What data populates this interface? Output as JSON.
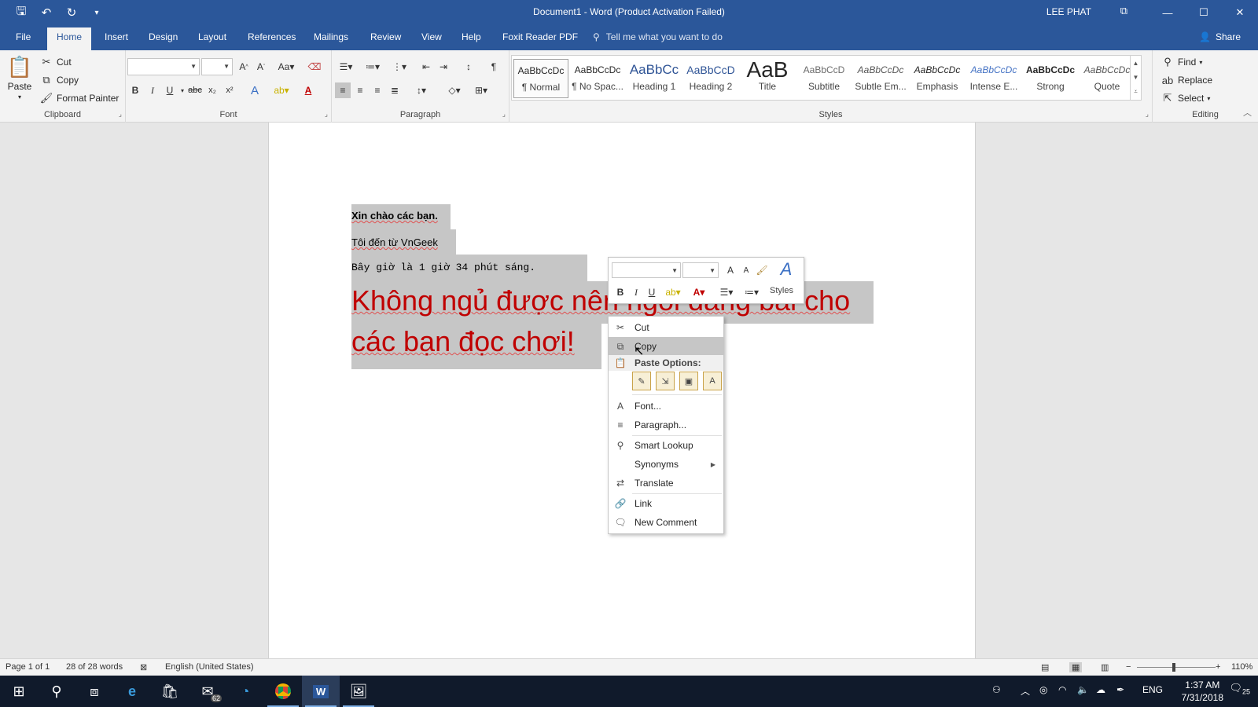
{
  "window": {
    "title": "Document1  -  Word (Product Activation Failed)",
    "user": "LEE PHAT",
    "controls": [
      "⧉",
      "—",
      "☐",
      "✕"
    ]
  },
  "tabs": [
    "File",
    "Home",
    "Insert",
    "Design",
    "Layout",
    "References",
    "Mailings",
    "Review",
    "View",
    "Help",
    "Foxit Reader PDF"
  ],
  "active_tab": "Home",
  "tell_me": "Tell me what you want to do",
  "share": "Share",
  "clipboard": {
    "label": "Clipboard",
    "paste": "Paste",
    "cut": "Cut",
    "copy": "Copy",
    "format_painter": "Format Painter"
  },
  "font_group": {
    "label": "Font",
    "font_name": "",
    "font_size": ""
  },
  "paragraph_group": {
    "label": "Paragraph"
  },
  "styles": {
    "label": "Styles",
    "items": [
      {
        "preview": "AaBbCcDc",
        "name": "¶ Normal"
      },
      {
        "preview": "AaBbCcDc",
        "name": "¶ No Spac..."
      },
      {
        "preview": "AaBbCc",
        "name": "Heading 1"
      },
      {
        "preview": "AaBbCcD",
        "name": "Heading 2"
      },
      {
        "preview": "AaB",
        "name": "Title"
      },
      {
        "preview": "AaBbCcD",
        "name": "Subtitle"
      },
      {
        "preview": "AaBbCcDc",
        "name": "Subtle Em..."
      },
      {
        "preview": "AaBbCcDc",
        "name": "Emphasis"
      },
      {
        "preview": "AaBbCcDc",
        "name": "Intense E..."
      },
      {
        "preview": "AaBbCcDc",
        "name": "Strong"
      },
      {
        "preview": "AaBbCcDc",
        "name": "Quote"
      }
    ]
  },
  "editing": {
    "label": "Editing",
    "find": "Find",
    "replace": "Replace",
    "select": "Select"
  },
  "document": {
    "lines": [
      "Xin chào các bạn.",
      "Tôi đến từ VnGeek",
      "Bây giờ là 1 giờ 34 phút sáng.",
      "Không ngủ được nên ngồi đăng bài cho",
      "các bạn đọc chơi!"
    ],
    "colors": {
      "selection": "#c6c6c6",
      "red_text": "#c00000"
    }
  },
  "mini_toolbar": {
    "styles_label": "Styles"
  },
  "context_menu": {
    "cut": "Cut",
    "copy": "Copy",
    "paste_options": "Paste Options:",
    "font": "Font...",
    "paragraph": "Paragraph...",
    "smart_lookup": "Smart Lookup",
    "synonyms": "Synonyms",
    "translate": "Translate",
    "link": "Link",
    "new_comment": "New Comment"
  },
  "status": {
    "page": "Page 1 of 1",
    "words": "28 of 28 words",
    "language": "English (United States)",
    "zoom": "110%"
  },
  "taskbar": {
    "mail_badge": "62",
    "language": "ENG",
    "time": "1:37 AM",
    "date": "7/31/2018",
    "notifications": "25"
  },
  "accent_colors": {
    "word_blue": "#2b579a",
    "taskbar": "#101a2b"
  }
}
